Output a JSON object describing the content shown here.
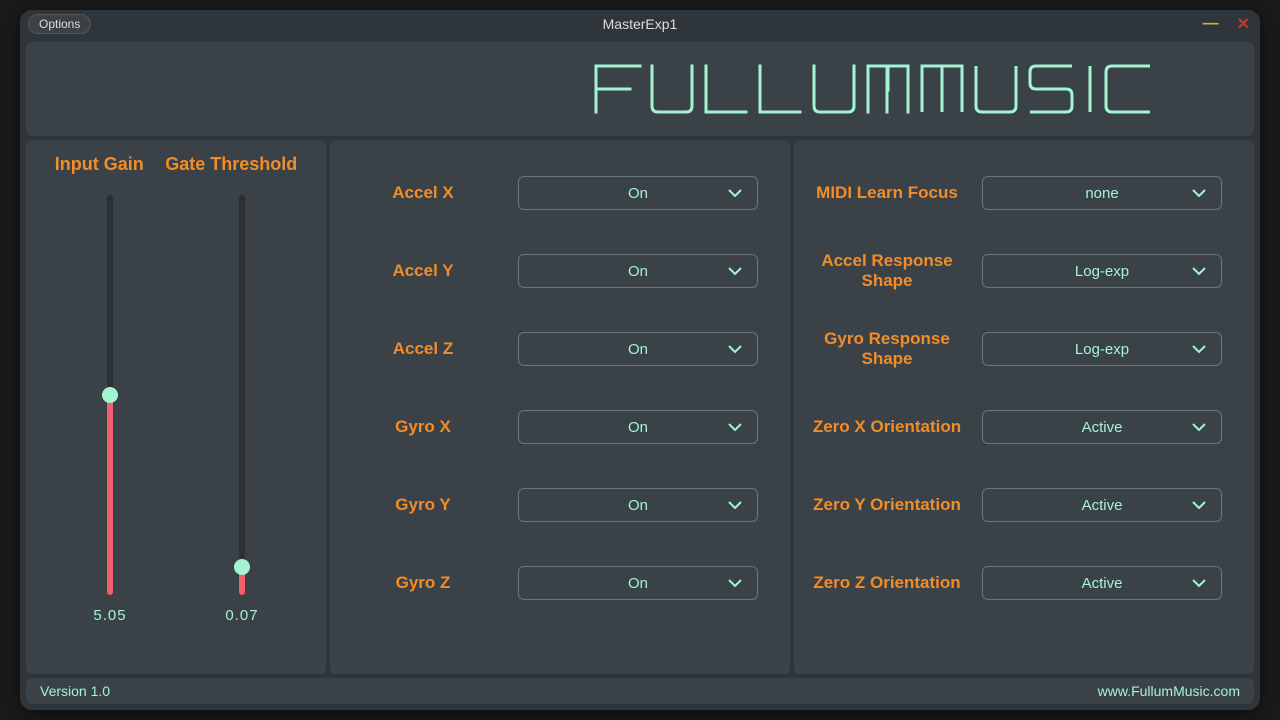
{
  "window": {
    "options_label": "Options",
    "title": "MasterExp1"
  },
  "brand": {
    "name": "FULLUMMUSIC"
  },
  "sliders": {
    "input_gain": {
      "label": "Input Gain",
      "value": "5.05",
      "fill_pct": 50
    },
    "gate_threshold": {
      "label": "Gate Threshold",
      "value": "0.07",
      "fill_pct": 7
    }
  },
  "axis_toggles": {
    "accel_x": {
      "label": "Accel X",
      "value": "On"
    },
    "accel_y": {
      "label": "Accel Y",
      "value": "On"
    },
    "accel_z": {
      "label": "Accel Z",
      "value": "On"
    },
    "gyro_x": {
      "label": "Gyro X",
      "value": "On"
    },
    "gyro_y": {
      "label": "Gyro Y",
      "value": "On"
    },
    "gyro_z": {
      "label": "Gyro Z",
      "value": "On"
    }
  },
  "settings": {
    "midi_learn": {
      "label": "MIDI Learn Focus",
      "value": "none"
    },
    "accel_shape": {
      "label": "Accel Response Shape",
      "value": "Log-exp"
    },
    "gyro_shape": {
      "label": "Gyro Response Shape",
      "value": "Log-exp"
    },
    "zero_x": {
      "label": "Zero X Orientation",
      "value": "Active"
    },
    "zero_y": {
      "label": "Zero Y Orientation",
      "value": "Active"
    },
    "zero_z": {
      "label": "Zero Z Orientation",
      "value": "Active"
    }
  },
  "footer": {
    "version": "Version 1.0",
    "url": "www.FullumMusic.com"
  }
}
